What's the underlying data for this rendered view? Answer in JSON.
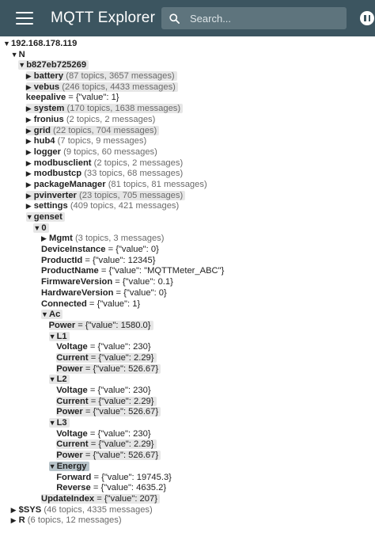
{
  "app": {
    "title": "MQTT Explorer",
    "search_placeholder": "Search..."
  },
  "tree": [
    {
      "indent": 0,
      "arrow": "▼",
      "key": "192.168.178.119",
      "meta": "",
      "value": "",
      "hl": false
    },
    {
      "indent": 1,
      "arrow": "▼",
      "key": "N",
      "meta": "",
      "value": "",
      "hl": false
    },
    {
      "indent": 2,
      "arrow": "▼",
      "key": "b827eb725269",
      "meta": "",
      "value": "",
      "hl": true
    },
    {
      "indent": 3,
      "arrow": "▶",
      "key": "battery",
      "meta": "(87 topics, 3657 messages)",
      "value": "",
      "hl": true
    },
    {
      "indent": 3,
      "arrow": "▶",
      "key": "vebus",
      "meta": "(246 topics, 4433 messages)",
      "value": "",
      "hl": true
    },
    {
      "indent": 3,
      "arrow": "",
      "key": "keepalive",
      "meta": "",
      "value": "= {\"value\": 1}",
      "hl": false
    },
    {
      "indent": 3,
      "arrow": "▶",
      "key": "system",
      "meta": "(170 topics, 1638 messages)",
      "value": "",
      "hl": true
    },
    {
      "indent": 3,
      "arrow": "▶",
      "key": "fronius",
      "meta": "(2 topics, 2 messages)",
      "value": "",
      "hl": false
    },
    {
      "indent": 3,
      "arrow": "▶",
      "key": "grid",
      "meta": "(22 topics, 704 messages)",
      "value": "",
      "hl": true
    },
    {
      "indent": 3,
      "arrow": "▶",
      "key": "hub4",
      "meta": "(7 topics, 9 messages)",
      "value": "",
      "hl": false
    },
    {
      "indent": 3,
      "arrow": "▶",
      "key": "logger",
      "meta": "(9 topics, 60 messages)",
      "value": "",
      "hl": false
    },
    {
      "indent": 3,
      "arrow": "▶",
      "key": "modbusclient",
      "meta": "(2 topics, 2 messages)",
      "value": "",
      "hl": false
    },
    {
      "indent": 3,
      "arrow": "▶",
      "key": "modbustcp",
      "meta": "(33 topics, 68 messages)",
      "value": "",
      "hl": false
    },
    {
      "indent": 3,
      "arrow": "▶",
      "key": "packageManager",
      "meta": "(81 topics, 81 messages)",
      "value": "",
      "hl": false
    },
    {
      "indent": 3,
      "arrow": "▶",
      "key": "pvinverter",
      "meta": "(23 topics, 705 messages)",
      "value": "",
      "hl": true
    },
    {
      "indent": 3,
      "arrow": "▶",
      "key": "settings",
      "meta": "(409 topics, 421 messages)",
      "value": "",
      "hl": false
    },
    {
      "indent": 3,
      "arrow": "▼",
      "key": "genset",
      "meta": "",
      "value": "",
      "hl": true
    },
    {
      "indent": 4,
      "arrow": "▼",
      "key": "0",
      "meta": "",
      "value": "",
      "hl": true
    },
    {
      "indent": 5,
      "arrow": "▶",
      "key": "Mgmt",
      "meta": "(3 topics, 3 messages)",
      "value": "",
      "hl": false
    },
    {
      "indent": 5,
      "arrow": "",
      "key": "DeviceInstance",
      "meta": "",
      "value": "= {\"value\": 0}",
      "hl": false
    },
    {
      "indent": 5,
      "arrow": "",
      "key": "ProductId",
      "meta": "",
      "value": "= {\"value\": 12345}",
      "hl": false
    },
    {
      "indent": 5,
      "arrow": "",
      "key": "ProductName",
      "meta": "",
      "value": "= {\"value\": \"MQTTMeter_ABC\"}",
      "hl": false
    },
    {
      "indent": 5,
      "arrow": "",
      "key": "FirmwareVersion",
      "meta": "",
      "value": "= {\"value\": 0.1}",
      "hl": false
    },
    {
      "indent": 5,
      "arrow": "",
      "key": "HardwareVersion",
      "meta": "",
      "value": "= {\"value\": 0}",
      "hl": false
    },
    {
      "indent": 5,
      "arrow": "",
      "key": "Connected",
      "meta": "",
      "value": "= {\"value\": 1}",
      "hl": false
    },
    {
      "indent": 5,
      "arrow": "▼",
      "key": "Ac",
      "meta": "",
      "value": "",
      "hl": true
    },
    {
      "indent": 6,
      "arrow": "",
      "key": "Power",
      "meta": "",
      "value": "= {\"value\": 1580.0}",
      "hl": true
    },
    {
      "indent": 6,
      "arrow": "▼",
      "key": "L1",
      "meta": "",
      "value": "",
      "hl": true
    },
    {
      "indent": 7,
      "arrow": "",
      "key": "Voltage",
      "meta": "",
      "value": "= {\"value\": 230}",
      "hl": false
    },
    {
      "indent": 7,
      "arrow": "",
      "key": "Current",
      "meta": "",
      "value": "= {\"value\": 2.29}",
      "hl": true
    },
    {
      "indent": 7,
      "arrow": "",
      "key": "Power",
      "meta": "",
      "value": "= {\"value\": 526.67}",
      "hl": true
    },
    {
      "indent": 6,
      "arrow": "▼",
      "key": "L2",
      "meta": "",
      "value": "",
      "hl": true
    },
    {
      "indent": 7,
      "arrow": "",
      "key": "Voltage",
      "meta": "",
      "value": "= {\"value\": 230}",
      "hl": false
    },
    {
      "indent": 7,
      "arrow": "",
      "key": "Current",
      "meta": "",
      "value": "= {\"value\": 2.29}",
      "hl": true
    },
    {
      "indent": 7,
      "arrow": "",
      "key": "Power",
      "meta": "",
      "value": "= {\"value\": 526.67}",
      "hl": true
    },
    {
      "indent": 6,
      "arrow": "▼",
      "key": "L3",
      "meta": "",
      "value": "",
      "hl": true
    },
    {
      "indent": 7,
      "arrow": "",
      "key": "Voltage",
      "meta": "",
      "value": "= {\"value\": 230}",
      "hl": false
    },
    {
      "indent": 7,
      "arrow": "",
      "key": "Current",
      "meta": "",
      "value": "= {\"value\": 2.29}",
      "hl": true
    },
    {
      "indent": 7,
      "arrow": "",
      "key": "Power",
      "meta": "",
      "value": "= {\"value\": 526.67}",
      "hl": true
    },
    {
      "indent": 6,
      "arrow": "▼",
      "key": "Energy",
      "meta": "",
      "value": "",
      "hl": "dark"
    },
    {
      "indent": 7,
      "arrow": "",
      "key": "Forward",
      "meta": "",
      "value": "= {\"value\": 19745.3}",
      "hl": false
    },
    {
      "indent": 7,
      "arrow": "",
      "key": "Reverse",
      "meta": "",
      "value": "= {\"value\": 4635.2}",
      "hl": false
    },
    {
      "indent": 5,
      "arrow": "",
      "key": "UpdateIndex",
      "meta": "",
      "value": "= {\"value\": 207}",
      "hl": true
    },
    {
      "indent": 1,
      "arrow": "▶",
      "key": "$SYS",
      "meta": "(46 topics, 4335 messages)",
      "value": "",
      "hl": false
    },
    {
      "indent": 1,
      "arrow": "▶",
      "key": "R",
      "meta": "(6 topics, 12 messages)",
      "value": "",
      "hl": false
    }
  ]
}
